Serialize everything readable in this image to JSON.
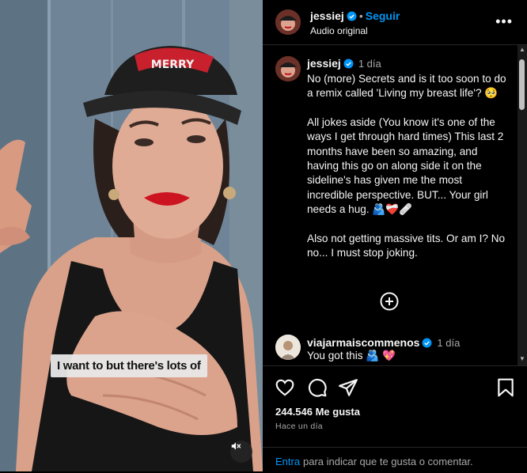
{
  "video": {
    "caption": "I want to but there's lots of",
    "cap_text": "MERRY",
    "mute_icon": "speaker-muted-icon"
  },
  "header": {
    "username": "jessiej",
    "dot": "•",
    "follow": "Seguir",
    "subtitle": "Audio original",
    "more": "•••"
  },
  "caption": {
    "username": "jessiej",
    "time": "1 día",
    "paragraphs": [
      "No (more) Secrets and is it too soon to do a remix called 'Living my breast life'? 🥺",
      "All jokes aside (You know it's one of the ways I get through hard times) This last 2 months have been so amazing, and having this go on along side it on the sideline's has given me the most incredible perspective. BUT... Your girl needs a hug. 🫂❤️‍🩹🩹",
      "Also not getting massive tits. Or am I? No no... I must stop joking."
    ]
  },
  "comment": {
    "username": "viajarmaiscommenos",
    "time": "1 día",
    "text": "You got this 🫂 💖"
  },
  "actions": {
    "likes": "244.546 Me gusta",
    "ago": "Hace un día"
  },
  "footer": {
    "link": "Entra",
    "text": "para indicar que te gusta o comentar."
  },
  "colors": {
    "accent": "#0095f6",
    "background": "#000000",
    "secondary_text": "#a8a8a8"
  }
}
